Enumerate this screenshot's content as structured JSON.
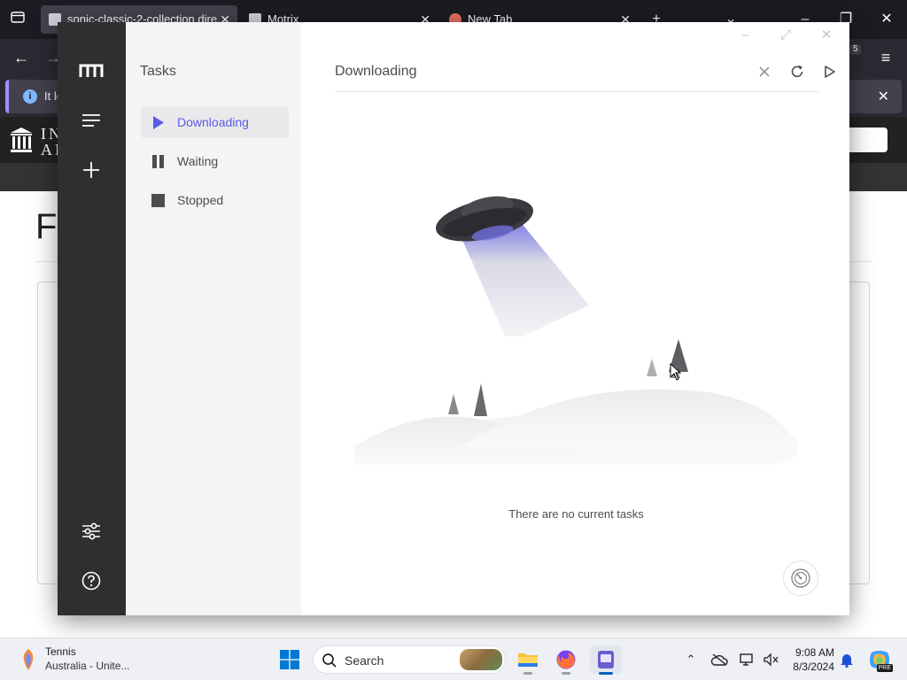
{
  "browser": {
    "tabs": [
      {
        "title": "sonic-classic-2-collection dire..."
      },
      {
        "title": "Motrix"
      },
      {
        "title": "New Tab"
      }
    ],
    "info_text": "It lo",
    "site_logo_line1": "IN",
    "site_logo_line2": "AR",
    "page_heading_partial": "F",
    "badge_count": "5"
  },
  "app": {
    "name": "Motrix",
    "sidebar": {
      "title": "Tasks",
      "items": [
        {
          "label": "Downloading",
          "icon": "play-icon",
          "active": true
        },
        {
          "label": "Waiting",
          "icon": "pause-icon",
          "active": false
        },
        {
          "label": "Stopped",
          "icon": "stop-icon",
          "active": false
        }
      ]
    },
    "main": {
      "title": "Downloading",
      "empty_text": "There are no current tasks"
    },
    "colors": {
      "accent": "#5b5bea",
      "rail": "#2f2f32",
      "panel": "#f4f4f5"
    }
  },
  "taskbar": {
    "weather_title": "Tennis",
    "weather_subtitle": "Australia - Unite...",
    "search_placeholder": "Search",
    "time": "9:08 AM",
    "date": "8/3/2024",
    "copilot_badge": "PRE"
  }
}
